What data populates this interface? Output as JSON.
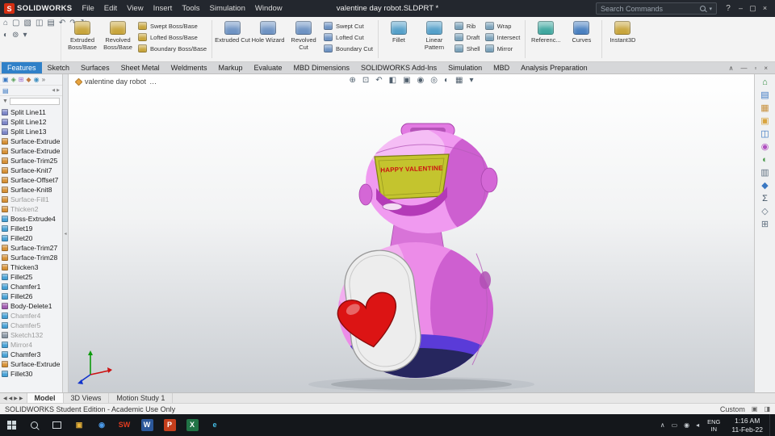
{
  "titlebar": {
    "logo_letter": "S",
    "app_name": "SOLIDWORKS",
    "menus": [
      "File",
      "Edit",
      "View",
      "Insert",
      "Tools",
      "Simulation",
      "Window"
    ],
    "document_title": "valentine day robot.SLDPRT *",
    "search_placeholder": "Search Commands",
    "help_label": "?",
    "win_min": "–",
    "win_max": "▢",
    "win_close": "×"
  },
  "glyphs": {
    "caret": "▾",
    "splitter": "◂",
    "ellipsis": "…"
  },
  "quick_access": {
    "row1": [
      {
        "name": "home",
        "glyph": "⌂"
      },
      {
        "name": "new",
        "glyph": "▢"
      },
      {
        "name": "open",
        "glyph": "▧"
      },
      {
        "name": "save",
        "glyph": "◫"
      },
      {
        "name": "print",
        "glyph": "▤"
      },
      {
        "name": "undo",
        "glyph": "↶"
      },
      {
        "name": "redo",
        "glyph": "↷"
      },
      {
        "name": "rebuild",
        "glyph": "↻"
      }
    ],
    "row2": [
      {
        "name": "appearance",
        "glyph": "◐"
      },
      {
        "name": "options",
        "glyph": "⊚"
      },
      {
        "name": "more",
        "glyph": "▾"
      }
    ]
  },
  "ribbon": {
    "g1_big": [
      {
        "label": "Extruded Boss/Base",
        "color": "#c8a53c"
      },
      {
        "label": "Revolved Boss/Base",
        "color": "#c8a53c"
      }
    ],
    "g1_stack": [
      {
        "label": "Swept Boss/Base",
        "color": "#c8a53c"
      },
      {
        "label": "Lofted Boss/Base",
        "color": "#c8a53c"
      },
      {
        "label": "Boundary Boss/Base",
        "color": "#c8a53c"
      }
    ],
    "g2_big": [
      {
        "label": "Extruded Cut",
        "color": "#6e93c3"
      },
      {
        "label": "Hole Wizard",
        "color": "#6e93c3"
      },
      {
        "label": "Revolved Cut",
        "color": "#6e93c3"
      }
    ],
    "g2_stack": [
      {
        "label": "Swept Cut",
        "color": "#6e93c3"
      },
      {
        "label": "Lofted Cut",
        "color": "#6e93c3"
      },
      {
        "label": "Boundary Cut",
        "color": "#6e93c3"
      }
    ],
    "g3_big": [
      {
        "label": "Fillet",
        "color": "#55a0c9"
      },
      {
        "label": "Linear Pattern",
        "color": "#55a0c9"
      }
    ],
    "g3_stack1": [
      {
        "label": "Rib",
        "color": "#7ba2ba"
      },
      {
        "label": "Draft",
        "color": "#7ba2ba"
      },
      {
        "label": "Shell",
        "color": "#7ba2ba"
      }
    ],
    "g3_stack2": [
      {
        "label": "Wrap",
        "color": "#7ba2ba"
      },
      {
        "label": "Intersect",
        "color": "#7ba2ba"
      },
      {
        "label": "Mirror",
        "color": "#7ba2ba"
      }
    ],
    "g4_big": [
      {
        "label": "Referenc...",
        "color": "#3fa79f"
      },
      {
        "label": "Curves",
        "color": "#4a80c0"
      }
    ],
    "g5_big": [
      {
        "label": "Instant3D",
        "color": "#c8a53c"
      }
    ]
  },
  "command_tabs": [
    {
      "label": "Features",
      "active": true
    },
    {
      "label": "Sketch"
    },
    {
      "label": "Surfaces"
    },
    {
      "label": "Sheet Metal"
    },
    {
      "label": "Weldments"
    },
    {
      "label": "Markup"
    },
    {
      "label": "Evaluate"
    },
    {
      "label": "MBD Dimensions"
    },
    {
      "label": "SOLIDWORKS Add-Ins"
    },
    {
      "label": "Simulation"
    },
    {
      "label": "MBD"
    },
    {
      "label": "Analysis Preparation"
    }
  ],
  "cm_controls": [
    "∧",
    "—",
    "▫",
    "×"
  ],
  "panel": {
    "tabs": [
      {
        "glyph": "▣",
        "color": "#3a78c2"
      },
      {
        "glyph": "◈",
        "color": "#58a058"
      },
      {
        "glyph": "⊞",
        "color": "#9a6ad0"
      },
      {
        "glyph": "◆",
        "color": "#c07840"
      },
      {
        "glyph": "◉",
        "color": "#4090c0"
      },
      {
        "glyph": "»",
        "color": "#666666"
      }
    ],
    "display_pane_glyph": "▤",
    "arrow_left": "◀",
    "arrow_right": "▶",
    "filter_glyph": "▼"
  },
  "feature_tree": {
    "items": [
      {
        "label": "Split Line11",
        "icon_color": "#7b85c8"
      },
      {
        "label": "Split Line12",
        "icon_color": "#7b85c8"
      },
      {
        "label": "Split Line13",
        "icon_color": "#7b85c8"
      },
      {
        "label": "Surface-Extrude",
        "icon_color": "#d69035"
      },
      {
        "label": "Surface-Extrude",
        "icon_color": "#d69035"
      },
      {
        "label": "Surface-Trim25",
        "icon_color": "#d69035"
      },
      {
        "label": "Surface-Knit7",
        "icon_color": "#d69035"
      },
      {
        "label": "Surface-Offset7",
        "icon_color": "#d69035"
      },
      {
        "label": "Surface-Knit8",
        "icon_color": "#d69035"
      },
      {
        "label": "Surface-Fill1",
        "icon_color": "#d69035",
        "dim": true
      },
      {
        "label": "Thicken2",
        "icon_color": "#d69035",
        "dim": true
      },
      {
        "label": "Boss-Extrude4",
        "icon_color": "#45a0d6"
      },
      {
        "label": "Fillet19",
        "icon_color": "#45a0d6"
      },
      {
        "label": "Fillet20",
        "icon_color": "#45a0d6"
      },
      {
        "label": "Surface-Trim27",
        "icon_color": "#d69035"
      },
      {
        "label": "Surface-Trim28",
        "icon_color": "#d69035"
      },
      {
        "label": "Thicken3",
        "icon_color": "#d69035"
      },
      {
        "label": "Fillet25",
        "icon_color": "#45a0d6"
      },
      {
        "label": "Chamfer1",
        "icon_color": "#45a0d6"
      },
      {
        "label": "Fillet26",
        "icon_color": "#45a0d6"
      },
      {
        "label": "Body-Delete1",
        "icon_color": "#a05ab0"
      },
      {
        "label": "Chamfer4",
        "icon_color": "#45a0d6",
        "dim": true
      },
      {
        "label": "Chamfer5",
        "icon_color": "#45a0d6",
        "dim": true
      },
      {
        "label": "Sketch132",
        "icon_color": "#8a97a5",
        "dim": true
      },
      {
        "label": "Mirror4",
        "icon_color": "#45a0d6",
        "dim": true
      },
      {
        "label": "Chamfer3",
        "icon_color": "#45a0d6"
      },
      {
        "label": "Surface-Extrude",
        "icon_color": "#d69035"
      },
      {
        "label": "Fillet30",
        "icon_color": "#45a0d6"
      }
    ]
  },
  "viewport": {
    "breadcrumb": "valentine day robot",
    "hud_icons": [
      "⊕",
      "⊡",
      "↶",
      "◧",
      "▣",
      "◉",
      "◎",
      "◐",
      "▦",
      "▾"
    ]
  },
  "task_pane": {
    "icons": [
      {
        "glyph": "⌂",
        "color": "#2e8b3e"
      },
      {
        "glyph": "▤",
        "color": "#3a78c2"
      },
      {
        "glyph": "▦",
        "color": "#c78f3a"
      },
      {
        "glyph": "▣",
        "color": "#d8a43c"
      },
      {
        "glyph": "◫",
        "color": "#3a78c2"
      },
      {
        "glyph": "◉",
        "color": "#b04fc0"
      },
      {
        "glyph": "◐",
        "color": "#4a9a4a"
      },
      {
        "glyph": "▥",
        "color": "#607080"
      },
      {
        "glyph": "◆",
        "color": "#3a78c2"
      },
      {
        "glyph": "Σ",
        "color": "#445566"
      },
      {
        "glyph": "◇",
        "color": "#607080"
      },
      {
        "glyph": "⊞",
        "color": "#607080"
      }
    ]
  },
  "bottom_bar": {
    "nav": [
      "◀",
      "◀",
      "▶",
      "▶"
    ],
    "tabs": [
      {
        "label": "Model",
        "active": true
      },
      {
        "label": "3D Views"
      },
      {
        "label": "Motion Study 1"
      }
    ]
  },
  "status_bar": {
    "left": "SOLIDWORKS Student Edition - Academic Use Only",
    "right": "Custom",
    "icons": [
      "▣",
      "◨"
    ]
  },
  "taskbar": {
    "apps": [
      {
        "name": "file-explorer",
        "glyph": "▣",
        "fg": "#e8b339"
      },
      {
        "name": "browser",
        "glyph": "◉",
        "fg": "#4a9ae8"
      },
      {
        "name": "solidworks",
        "glyph": "SW",
        "fg": "#e03c20"
      },
      {
        "name": "word",
        "glyph": "W",
        "fg": "#ffffff",
        "bg": "#2b579a"
      },
      {
        "name": "powerpoint",
        "glyph": "P",
        "fg": "#ffffff",
        "bg": "#c43e1c"
      },
      {
        "name": "excel",
        "glyph": "X",
        "fg": "#ffffff",
        "bg": "#217346"
      },
      {
        "name": "edge",
        "glyph": "e",
        "fg": "#45c0e8"
      }
    ],
    "tray_expand": "∧",
    "battery_glyph": "▭",
    "network_glyph": "◉",
    "volume_glyph": "◂",
    "lang_line1": "ENG",
    "lang_line2": "IN",
    "time": "1:16 AM",
    "date": "11-Feb-22"
  },
  "robot": {
    "face_text": "HAPPY VALENTINE",
    "colors": {
      "head": "#f09af0",
      "body": "#ec8ce8",
      "shade": "#c450c8",
      "screen": "#c4c42e",
      "screen_text": "#cc1111",
      "visor": "#b43ab8",
      "heart": "#dc1414",
      "band": "#5a3bd8",
      "base": "#26265e",
      "panel": "#ededed"
    }
  }
}
